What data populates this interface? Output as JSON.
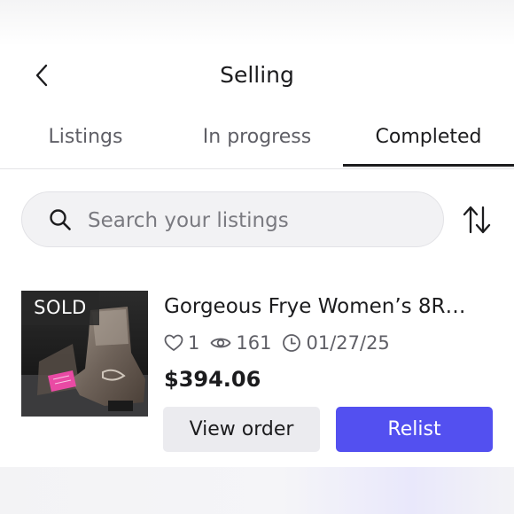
{
  "header": {
    "title": "Selling"
  },
  "tabs": [
    {
      "label": "Listings",
      "active": false
    },
    {
      "label": "In progress",
      "active": false
    },
    {
      "label": "Completed",
      "active": true
    }
  ],
  "search": {
    "placeholder": "Search your listings",
    "value": ""
  },
  "listing": {
    "badge": "SOLD",
    "title": "Gorgeous Frye Women’s 8R…",
    "likes": "1",
    "views": "161",
    "date": "01/27/25",
    "price": "$394.06",
    "view_order_label": "View order",
    "relist_label": "Relist"
  },
  "icons": {
    "back": "chevron-left-icon",
    "search": "search-icon",
    "sort": "sort-arrows-icon",
    "likes": "heart-icon",
    "views": "eye-icon",
    "date": "clock-icon"
  },
  "colors": {
    "accent": "#5350f0",
    "text_primary": "#1c1c1e",
    "text_secondary": "#5f5f66",
    "search_bg": "#f2f2f4",
    "secondary_button_bg": "#ebebef"
  }
}
